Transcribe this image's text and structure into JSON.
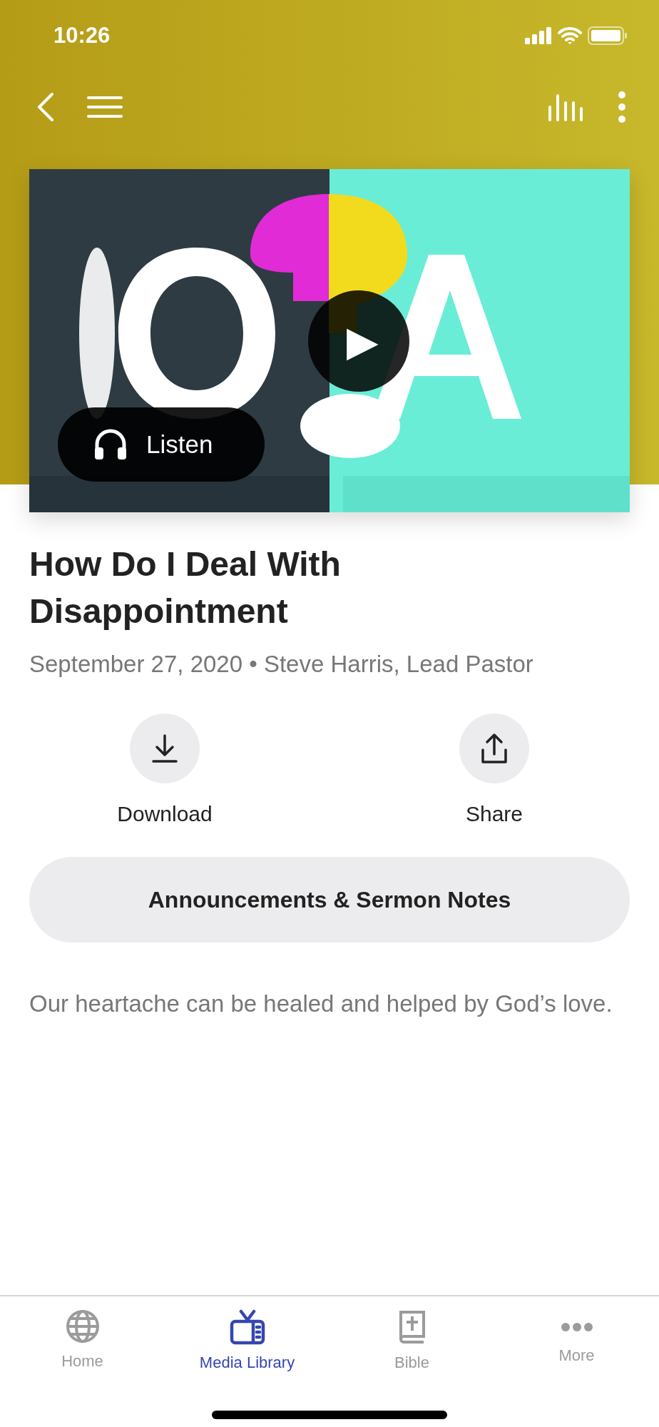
{
  "status_bar": {
    "time": "10:26"
  },
  "play_button": {
    "label": "▶"
  },
  "listen_button": {
    "label": "Listen"
  },
  "title": "How Do I Deal With Disappointment",
  "meta": {
    "date": "September 27, 2020",
    "separator": "•",
    "speaker": "Steve Harris, Lead Pastor"
  },
  "actions": [
    {
      "kind": "download",
      "label": "Download"
    },
    {
      "kind": "share",
      "label": "Share"
    }
  ],
  "notes_button": {
    "label": "Announcements & Sermon Notes"
  },
  "description": "Our heartache can be healed and helped by God’s love.",
  "tab_bar": [
    {
      "kind": "home",
      "label": "Home",
      "selected": false
    },
    {
      "kind": "media",
      "label": "Media Library",
      "selected": true
    },
    {
      "kind": "bible",
      "label": "Bible",
      "selected": false
    },
    {
      "kind": "more",
      "label": "More",
      "selected": false
    }
  ]
}
